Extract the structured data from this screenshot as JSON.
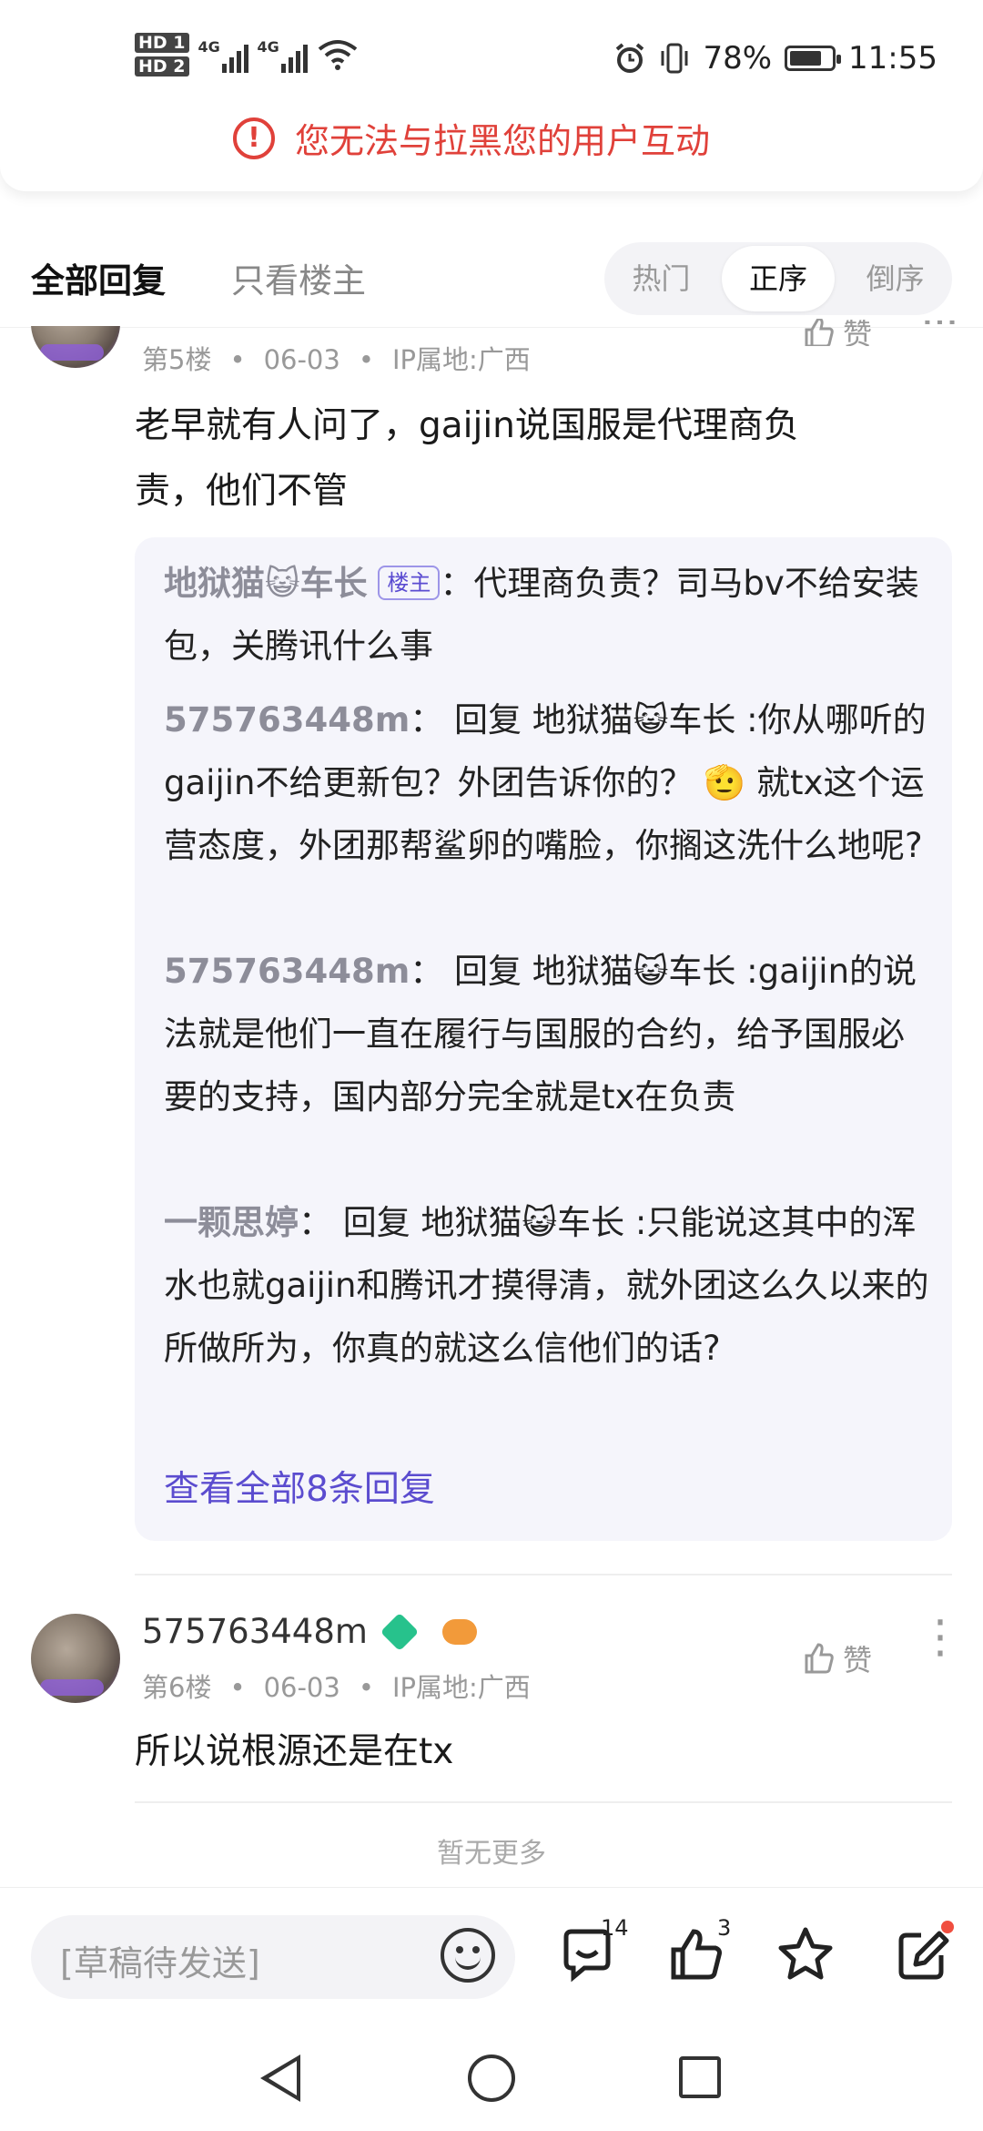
{
  "status_bar": {
    "hd1": "HD 1",
    "hd2": "HD 2",
    "net1": "4G",
    "net2": "4G",
    "battery": "78%",
    "time": "11:55"
  },
  "banner": {
    "warning_text": "您无法与拉黑您的用户互动"
  },
  "tabs": {
    "all_replies": "全部回复",
    "op_only": "只看楼主",
    "sort": [
      "热门",
      "正序",
      "倒序"
    ],
    "sort_selected": "正序"
  },
  "post5": {
    "floor": "第5楼",
    "date": "06-03",
    "ip": "IP属地:广西",
    "like_label": "赞",
    "content_line1": "老早就有人问了，gaijin说国服是代理商负",
    "content_line2": "责，他们不管",
    "replies": [
      {
        "author": "地狱猫😺车长",
        "badge": "楼主",
        "text": "：代理商负责？司马bv不给安装包，关腾讯什么事"
      },
      {
        "author": "575763448m",
        "text": "： 回复 地狱猫😺车长 :你从哪听的gaijin不给更新包？外团告诉你的？ 🫡 就tx这个运营态度，外团那帮鲨卵的嘴脸，你搁这洗什么地呢?"
      },
      {
        "author": "575763448m",
        "text": "： 回复 地狱猫😺车长 :gaijin的说法就是他们一直在履行与国服的合约，给予国服必要的支持，国内部分完全就是tx在负责"
      },
      {
        "author": "一颗思婷",
        "text": "： 回复 地狱猫😺车长 :只能说这其中的浑水也就gaijin和腾讯才摸得清，就外团这么久以来的所做所为，你真的就这么信他们的话?"
      }
    ],
    "view_all": "查看全部8条回复"
  },
  "post6": {
    "username": "575763448m",
    "floor": "第6楼",
    "date": "06-03",
    "ip": "IP属地:广西",
    "like_label": "赞",
    "content": "所以说根源还是在tx"
  },
  "no_more": "暂无更多",
  "bottom_bar": {
    "draft_placeholder": "[草稿待发送]",
    "comment_count": "14",
    "like_count": "3"
  },
  "icons": {
    "comment": "comment-icon",
    "like": "thumbs-up-icon",
    "favorite": "star-icon",
    "share": "edit-share-icon"
  }
}
